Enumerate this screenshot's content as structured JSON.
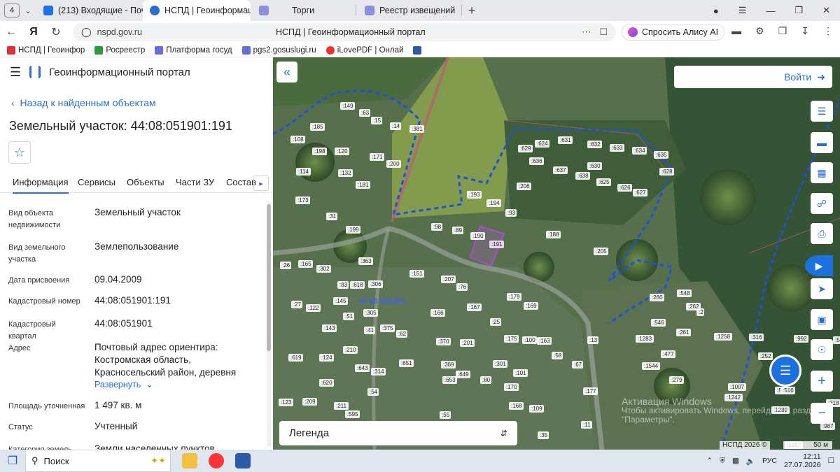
{
  "browser": {
    "tab_count": "4",
    "tabs": [
      {
        "label": "(213) Входящие - Почта",
        "active": false
      },
      {
        "label": "НСПД | Геоинформац",
        "active": true
      },
      {
        "label": "Торги",
        "active": false
      },
      {
        "label": "Реестр извещений",
        "active": false
      }
    ],
    "address": {
      "url": "nspd.gov.ru",
      "page_title": "НСПД | Геоинформационный портал"
    },
    "alice_label": "Спросить Алису AI",
    "bookmarks": [
      "НСПД | Геоинфор",
      "Росреестр",
      "Платформа госуд",
      "pgs2.gosuslugi.ru",
      "iLovePDF | Онлай"
    ]
  },
  "panel": {
    "portal_title": "Геоинформационный портал",
    "back_link": "Назад к найденным объектам",
    "object_title": "Земельный участок: 44:08:051901:191",
    "tabs": [
      "Информация",
      "Сервисы",
      "Объекты",
      "Части ЗУ",
      "Состав"
    ],
    "fields": [
      {
        "label": "Вид объекта недвижимости",
        "value": "Земельный участок"
      },
      {
        "label": "Вид земельного участка",
        "value": "Землепользование"
      },
      {
        "label": "Дата присвоения",
        "value": "09.04.2009"
      },
      {
        "label": "Кадастровый номер",
        "value": "44:08:051901:191"
      },
      {
        "label": "Кадастровый квартал",
        "value": "44:08:051901"
      },
      {
        "label": "Адрес",
        "value": "Почтовый адрес ориентира: Костромская область, Красносельский район, деревня"
      },
      {
        "label": "Площадь уточненная",
        "value": "1 497 кв. м"
      },
      {
        "label": "Статус",
        "value": "Учтенный"
      },
      {
        "label": "Категория земель",
        "value": "Земли населенных пунктов"
      }
    ],
    "expand_label": "Развернуть"
  },
  "map": {
    "login_label": "Войти",
    "quarter_label": "44:08:051901",
    "legend_label": "Легенда",
    "watermark_title": "Активация Windows",
    "watermark_text": "Чтобы активировать Windows, перейдите в раздел \"Параметры\".",
    "copyright": "НСПД 2026 ©",
    "scale": "50 м",
    "parcels": [
      "149",
      "63",
      "185",
      "15",
      "14",
      "381",
      "108",
      "198",
      "120",
      "171",
      "200",
      "114",
      "132",
      "181",
      "173",
      "31",
      "199",
      "26",
      "165",
      "302",
      "363",
      "83",
      "618",
      "306",
      "27",
      "122",
      "145",
      "305",
      "51",
      "143",
      "41",
      "375",
      "62",
      "619",
      "124",
      "210",
      "643",
      "314",
      "651",
      "620",
      "54",
      "209",
      "211",
      "595",
      "123",
      "624",
      "631",
      "629",
      "632",
      "633",
      "634",
      "635",
      "636",
      "637",
      "630",
      "638",
      "628",
      "625",
      "626",
      "627",
      "206",
      "193",
      "194",
      "93",
      "98",
      "89",
      "190",
      "191",
      "188",
      "205",
      "151",
      "207",
      "76",
      "167",
      "179",
      "169",
      "166",
      "25",
      "370",
      "201",
      "175",
      "100",
      "163",
      "13",
      "58",
      "67",
      "301",
      "101",
      "369",
      "649",
      "653",
      "80",
      "170",
      "168",
      "109",
      "177",
      "55",
      "11",
      "35",
      "260",
      "548",
      "262",
      "546",
      "2",
      "261",
      "1258",
      "316",
      "992",
      "547",
      "1283",
      "477",
      "252",
      "1544",
      "279",
      "1007",
      "1242",
      "515",
      "516",
      "318",
      "1289",
      "987",
      "1287"
    ]
  },
  "taskbar": {
    "search_label": "Поиск",
    "lang": "РУС",
    "time": "12:11",
    "date": "27.07.2026"
  }
}
